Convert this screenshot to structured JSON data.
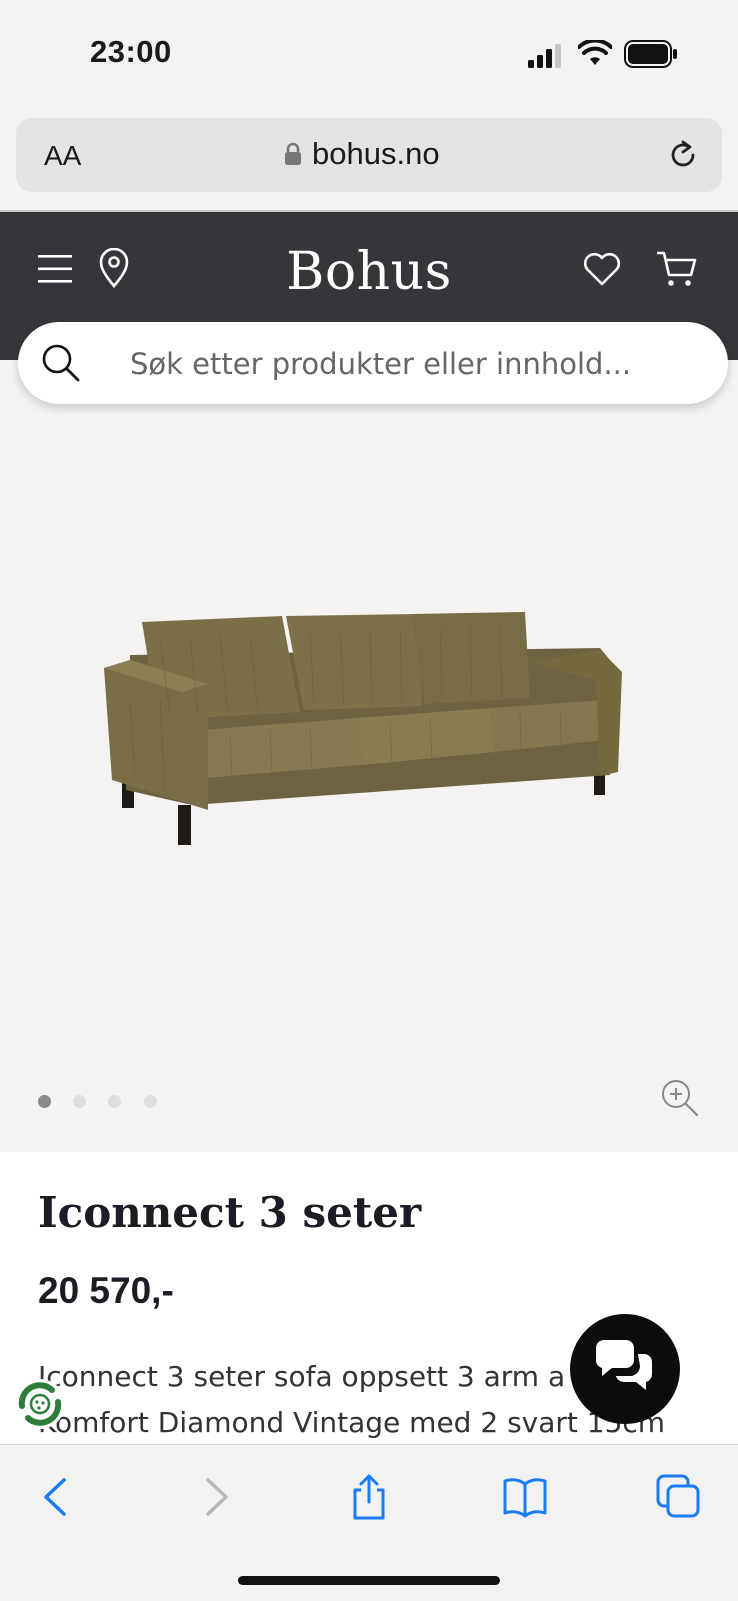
{
  "status_bar": {
    "time": "23:00"
  },
  "browser": {
    "text_size_label": "AA",
    "domain": "bohus.no"
  },
  "header": {
    "brand": "Bohus"
  },
  "search": {
    "placeholder": "Søk etter produkter eller innhold..."
  },
  "gallery": {
    "image_count": 4,
    "active_index": 0
  },
  "product": {
    "title": "Iconnect 3 seter",
    "price": "20 570,-",
    "description_line1": "Iconnect 3 seter sofa oppsett 3 arm a sofa",
    "description_line2": "Komfort Diamond Vintage med 2 svart 15cm"
  },
  "colors": {
    "header_bg": "#35353a",
    "accent_blue": "#1a7cf5",
    "chat_bg": "#0c0c0c",
    "leaf_green": "#2f7d3a"
  }
}
